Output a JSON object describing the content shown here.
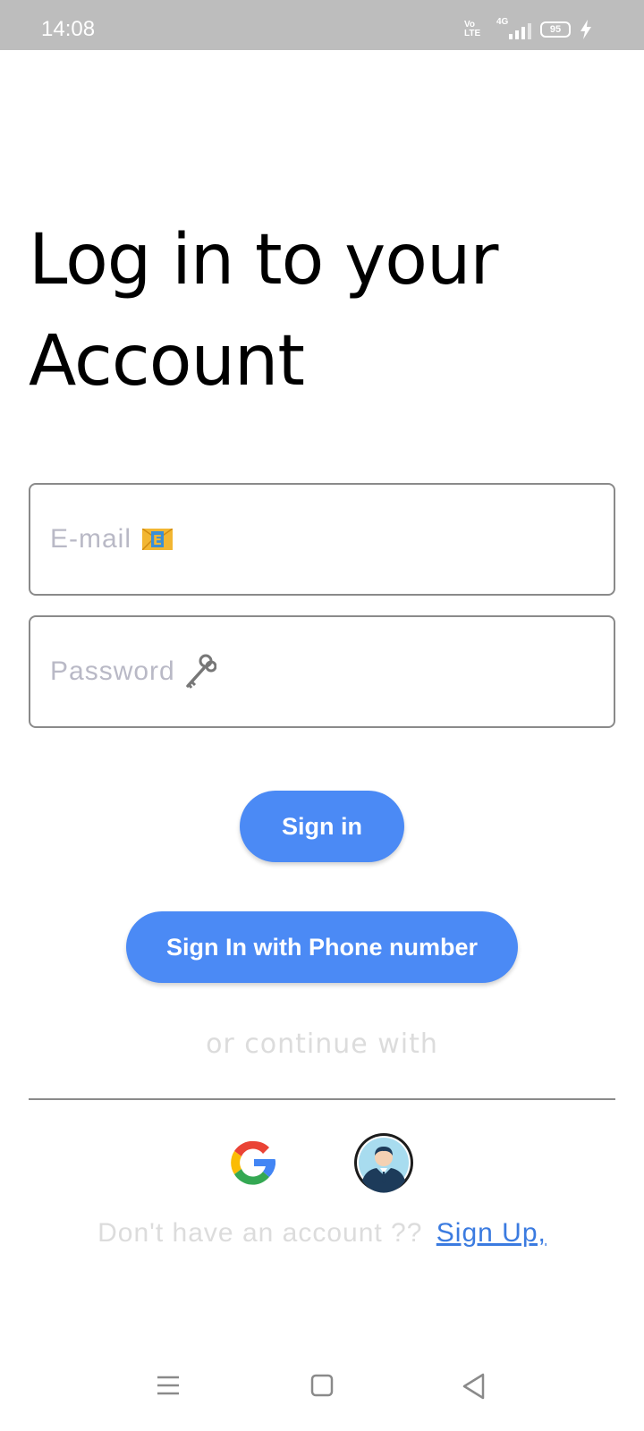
{
  "status_bar": {
    "time": "14:08",
    "volte_label": "Vo LTE",
    "network_label": "4G",
    "battery_level": "95"
  },
  "title": "Log in to your Account",
  "email": {
    "placeholder": "E-mail",
    "icon": "envelope-e-icon"
  },
  "password": {
    "placeholder": "Password",
    "icon": "old-key-icon"
  },
  "buttons": {
    "sign_in": "Sign in",
    "phone": "Sign In with Phone number"
  },
  "or_continue": "or continue with",
  "social": {
    "google_icon": "google-icon",
    "guest_icon": "avatar-icon"
  },
  "signup": {
    "prompt": "Don't have an account ??",
    "link": "Sign Up,"
  },
  "nav": {
    "menu_icon": "menu-icon",
    "home_icon": "home-square-icon",
    "back_icon": "back-triangle-icon"
  },
  "colors": {
    "accent": "#4b8af5",
    "link": "#3b7be0",
    "status_bar": "#bdbdbd",
    "placeholder": "#b9b9c6"
  }
}
